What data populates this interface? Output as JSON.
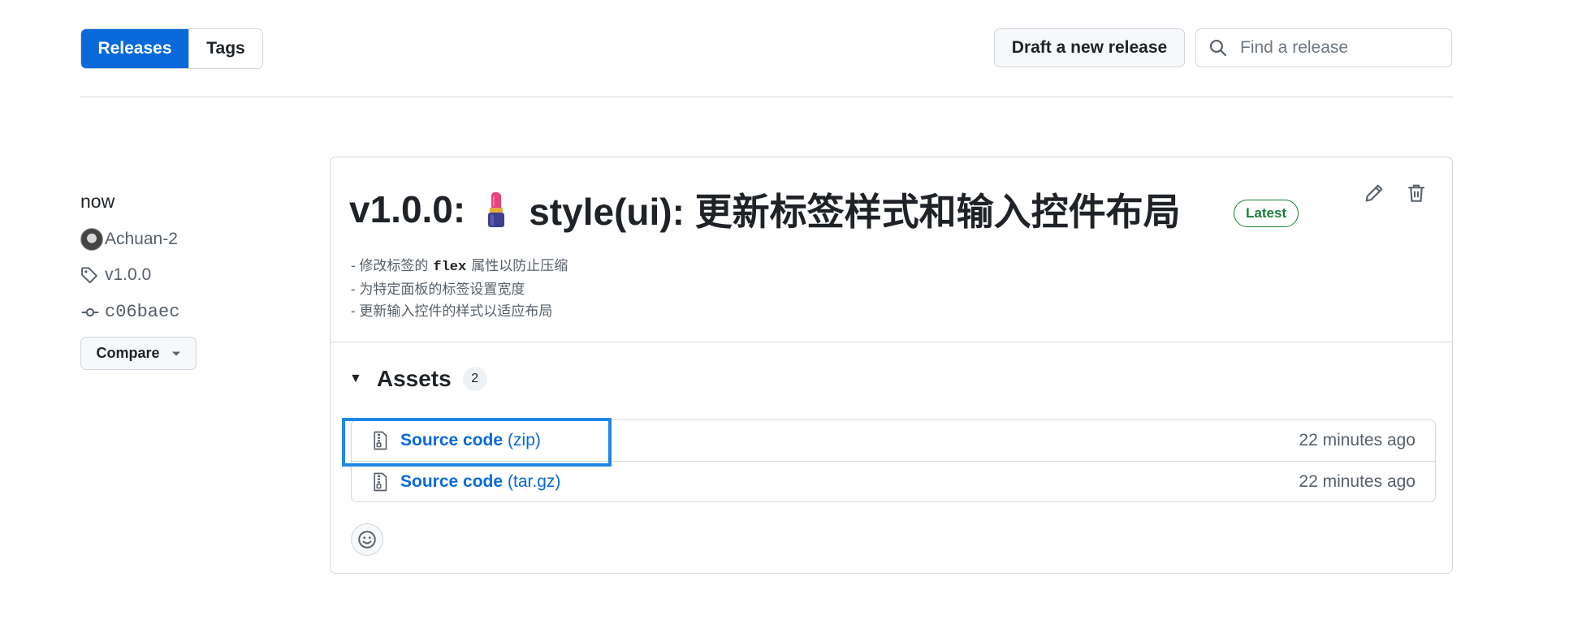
{
  "nav": {
    "tabs": [
      {
        "label": "Releases",
        "active": true
      },
      {
        "label": "Tags",
        "active": false
      }
    ],
    "draft_label": "Draft a new release",
    "search_placeholder": "Find a release"
  },
  "meta": {
    "when": "now",
    "author": "Achuan-2",
    "tag": "v1.0.0",
    "commit": "c06baec",
    "compare_label": "Compare"
  },
  "release": {
    "title_prefix": "v1.0.0:",
    "title_text": "style(ui): 更新标签样式和输入控件布局",
    "badge": "Latest",
    "notes": [
      {
        "pre": "- 修改标签的",
        "code": "flex",
        "post": "属性以防止压缩"
      },
      {
        "pre": "- 为特定面板的标签设置宽度",
        "code": "",
        "post": ""
      },
      {
        "pre": "- 更新输入控件的样式以适应布局",
        "code": "",
        "post": ""
      }
    ]
  },
  "assets": {
    "label": "Assets",
    "count": "2",
    "items": [
      {
        "name": "Source code",
        "ext": "(zip)",
        "time": "22 minutes ago"
      },
      {
        "name": "Source code",
        "ext": "(tar.gz)",
        "time": "22 minutes ago"
      }
    ]
  },
  "colors": {
    "accent": "#0969da",
    "latest": "#1a7f37",
    "highlight": "#1f88e5"
  }
}
